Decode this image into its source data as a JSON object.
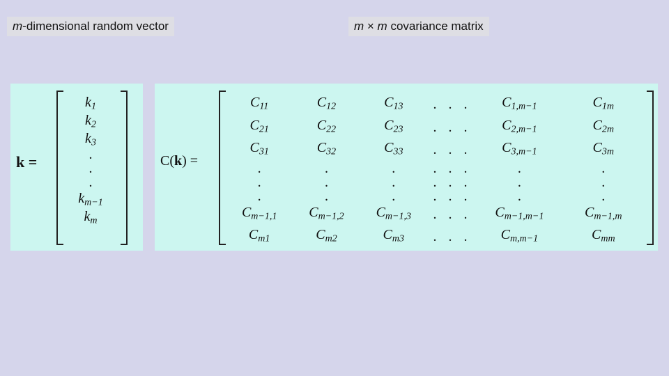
{
  "titles": {
    "left_prefix_m": "m",
    "left_rest": "-dimensional random vector",
    "right_m1": "m",
    "right_times": " × ",
    "right_m2": "m",
    "right_rest": " covariance matrix"
  },
  "vector": {
    "lhs": "k =",
    "entries": [
      "k",
      "k",
      "k",
      ".",
      ".",
      ".",
      "k",
      "k"
    ],
    "subs": [
      "1",
      "2",
      "3",
      "",
      "",
      "",
      "m−1",
      "m"
    ]
  },
  "cov": {
    "lhs_C": "C(",
    "lhs_k": "k",
    "lhs_close": ") =",
    "cols_sub_row1": [
      "11",
      "12",
      "13",
      "1,m−1",
      "1m"
    ],
    "grid": [
      {
        "type": "row",
        "c": [
          "C",
          "C",
          "C",
          ". . .",
          "C",
          "C"
        ],
        "s": [
          "11",
          "12",
          "13",
          "",
          "1,m−1",
          "1m"
        ]
      },
      {
        "type": "row",
        "c": [
          "C",
          "C",
          "C",
          ". . .",
          "C",
          "C"
        ],
        "s": [
          "21",
          "22",
          "23",
          "",
          "2,m−1",
          "2m"
        ]
      },
      {
        "type": "row",
        "c": [
          "C",
          "C",
          "C",
          ". . .",
          "C",
          "C"
        ],
        "s": [
          "31",
          "32",
          "33",
          "",
          "3,m−1",
          "3m"
        ]
      },
      {
        "type": "dot"
      },
      {
        "type": "dot"
      },
      {
        "type": "dot"
      },
      {
        "type": "row",
        "c": [
          "C",
          "C",
          "C",
          ". . .",
          "C",
          "C"
        ],
        "s": [
          "m−1,1",
          "m−1,2",
          "m−1,3",
          "",
          "m−1,m−1",
          "m−1,m"
        ]
      },
      {
        "type": "row",
        "c": [
          "C",
          "C",
          "C",
          ". . .",
          "C",
          "C"
        ],
        "s": [
          "m1",
          "m2",
          "m3",
          "",
          "m,m−1",
          "mm"
        ]
      }
    ]
  }
}
